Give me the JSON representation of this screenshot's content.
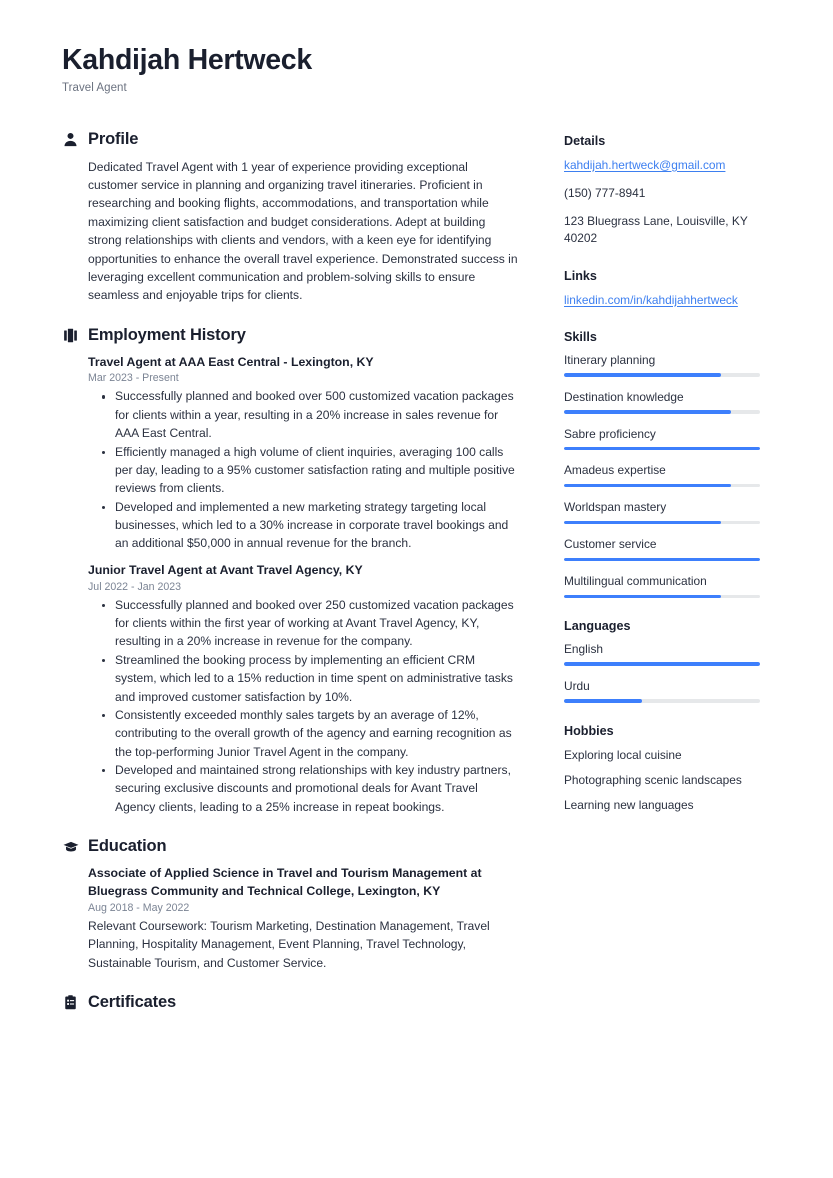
{
  "header": {
    "name": "Kahdijah Hertweck",
    "title": "Travel Agent"
  },
  "colors": {
    "accent": "#3d7ffc",
    "link": "#3d7ff0",
    "heading": "#1a1f2e",
    "body_text": "#2b3140",
    "muted_text": "#7b8494",
    "track": "#e6e8ea",
    "page_background": "#ffffff"
  },
  "main": {
    "profile": {
      "icon": "person-icon",
      "title": "Profile",
      "text": "Dedicated Travel Agent with 1 year of experience providing exceptional customer service in planning and organizing travel itineraries. Proficient in researching and booking flights, accommodations, and transportation while maximizing client satisfaction and budget considerations. Adept at building strong relationships with clients and vendors, with a keen eye for identifying opportunities to enhance the overall travel experience. Demonstrated success in leveraging excellent communication and problem-solving skills to ensure seamless and enjoyable trips for clients."
    },
    "employment": {
      "icon": "briefcase-icon",
      "title": "Employment History",
      "jobs": [
        {
          "title": "Travel Agent at AAA East Central - Lexington, KY",
          "date": "Mar 2023 - Present",
          "bullets": [
            "Successfully planned and booked over 500 customized vacation packages for clients within a year, resulting in a 20% increase in sales revenue for AAA East Central.",
            "Efficiently managed a high volume of client inquiries, averaging 100 calls per day, leading to a 95% customer satisfaction rating and multiple positive reviews from clients.",
            "Developed and implemented a new marketing strategy targeting local businesses, which led to a 30% increase in corporate travel bookings and an additional $50,000 in annual revenue for the branch."
          ]
        },
        {
          "title": "Junior Travel Agent at Avant Travel Agency, KY",
          "date": "Jul 2022 - Jan 2023",
          "bullets": [
            "Successfully planned and booked over 250 customized vacation packages for clients within the first year of working at Avant Travel Agency, KY, resulting in a 20% increase in revenue for the company.",
            "Streamlined the booking process by implementing an efficient CRM system, which led to a 15% reduction in time spent on administrative tasks and improved customer satisfaction by 10%.",
            "Consistently exceeded monthly sales targets by an average of 12%, contributing to the overall growth of the agency and earning recognition as the top-performing Junior Travel Agent in the company.",
            "Developed and maintained strong relationships with key industry partners, securing exclusive discounts and promotional deals for Avant Travel Agency clients, leading to a 25% increase in repeat bookings."
          ]
        }
      ]
    },
    "education": {
      "icon": "graduation-cap-icon",
      "title": "Education",
      "entries": [
        {
          "title": "Associate of Applied Science in Travel and Tourism Management at Bluegrass Community and Technical College, Lexington, KY",
          "date": "Aug 2018 - May 2022",
          "description": "Relevant Coursework: Tourism Marketing, Destination Management, Travel Planning, Hospitality Management, Event Planning, Travel Technology, Sustainable Tourism, and Customer Service."
        }
      ]
    },
    "certificates": {
      "icon": "clipboard-icon",
      "title": "Certificates"
    }
  },
  "sidebar": {
    "details": {
      "title": "Details",
      "email": "kahdijah.hertweck@gmail.com",
      "phone": "(150) 777-8941",
      "address": "123 Bluegrass Lane, Louisville, KY 40202"
    },
    "links": {
      "title": "Links",
      "items": [
        {
          "label": "linkedin.com/in/kahdijahhertweck"
        }
      ]
    },
    "skills": {
      "title": "Skills",
      "items": [
        {
          "label": "Itinerary planning",
          "level": 80
        },
        {
          "label": "Destination knowledge",
          "level": 85
        },
        {
          "label": "Sabre proficiency",
          "level": 100
        },
        {
          "label": "Amadeus expertise",
          "level": 85
        },
        {
          "label": "Worldspan mastery",
          "level": 80
        },
        {
          "label": "Customer service",
          "level": 100
        },
        {
          "label": "Multilingual communication",
          "level": 80
        }
      ]
    },
    "languages": {
      "title": "Languages",
      "items": [
        {
          "label": "English",
          "level": 100
        },
        {
          "label": "Urdu",
          "level": 40
        }
      ]
    },
    "hobbies": {
      "title": "Hobbies",
      "items": [
        {
          "label": "Exploring local cuisine"
        },
        {
          "label": "Photographing scenic landscapes"
        },
        {
          "label": "Learning new languages"
        }
      ]
    }
  }
}
